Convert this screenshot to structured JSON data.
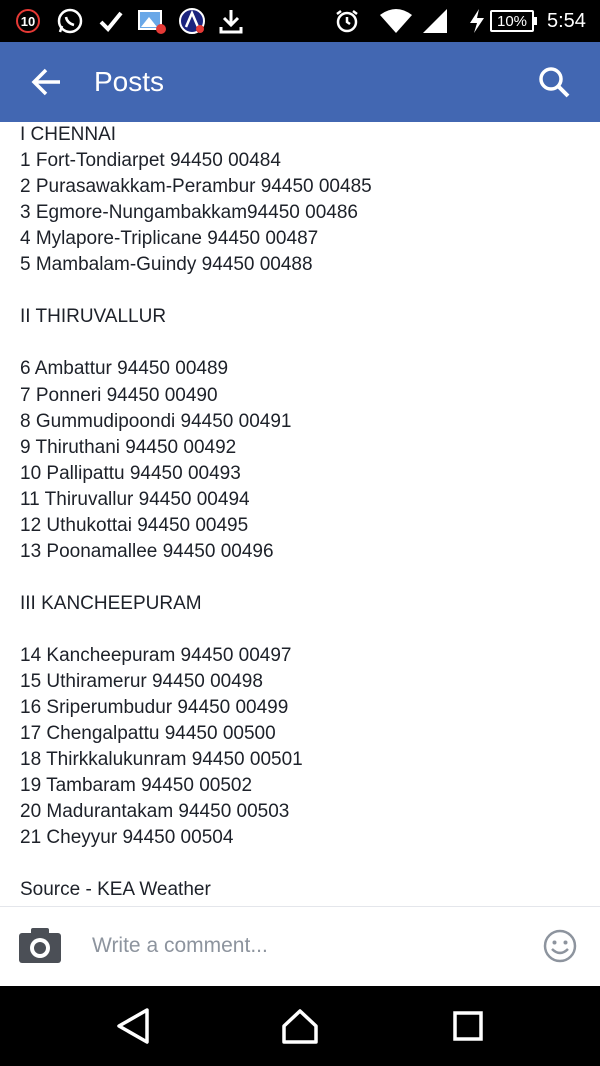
{
  "status_bar": {
    "notification_count": "10",
    "battery": "10%",
    "time": "5:54",
    "icons": [
      "whatsapp-icon",
      "check-icon",
      "gallery-icon",
      "app-icon",
      "download-icon",
      "alarm-icon",
      "wifi-icon",
      "signal-icon",
      "charging-icon"
    ]
  },
  "app_bar": {
    "title": "Posts",
    "back_icon": "back-arrow-icon",
    "search_icon": "search-icon"
  },
  "post": {
    "lines": [
      "I CHENNAI",
      "1 Fort-Tondiarpet 94450 00484",
      "2 Purasawakkam-Perambur 94450 00485",
      "3 Egmore-Nungambakkam94450 00486",
      "4 Mylapore-Triplicane 94450 00487",
      "5 Mambalam-Guindy 94450 00488",
      "",
      "II THIRUVALLUR",
      "",
      "6 Ambattur 94450 00489",
      "7 Ponneri 94450 00490",
      "8 Gummudipoondi 94450 00491",
      "9 Thiruthani 94450 00492",
      "10 Pallipattu 94450 00493",
      "11 Thiruvallur 94450 00494",
      "12 Uthukottai 94450 00495",
      "13 Poonamallee 94450 00496",
      "",
      "III KANCHEEPURAM",
      "",
      "14 Kancheepuram 94450 00497",
      "15 Uthiramerur 94450 00498",
      "16 Sriperumbudur 94450 00499",
      "17 Chengalpattu 94450 00500",
      "18 Thirkkalukunram 94450 00501",
      "19 Tambaram 94450 00502",
      "20 Madurantakam 94450 00503",
      "21 Cheyyur 94450 00504",
      "",
      "Source - KEA Weather"
    ]
  },
  "comment_bar": {
    "placeholder": "Write a comment...",
    "camera_icon": "camera-icon",
    "emoji_icon": "emoji-icon"
  },
  "nav_bar": {
    "icons": [
      "back-triangle-icon",
      "home-icon",
      "recents-square-icon"
    ]
  },
  "colors": {
    "app_bar": "#4267b2",
    "text": "#1d2129",
    "placeholder": "#8d949e"
  }
}
